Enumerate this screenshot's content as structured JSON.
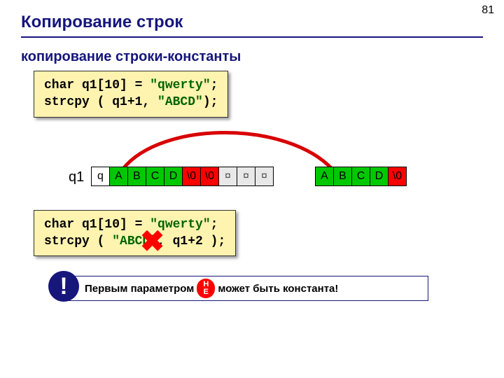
{
  "page_number": "81",
  "title": "Копирование строк",
  "subhead": "копирование строки-константы",
  "code1": {
    "line1_a": "char q1[10] = ",
    "line1_b": "\"qwerty\"",
    "line1_c": ";",
    "line2_a": "strcpy ( q1+1, ",
    "line2_b": "\"ABCD\"",
    "line2_c": ");"
  },
  "array_label": "q1",
  "array1": [
    "q",
    "A",
    "B",
    "C",
    "D",
    "\\0",
    "\\0",
    "¤",
    "¤",
    "¤"
  ],
  "array2": [
    "A",
    "B",
    "C",
    "D",
    "\\0"
  ],
  "code2": {
    "line1_a": "char q1[10] = ",
    "line1_b": "\"qwerty\"",
    "line1_c": ";",
    "line2_a": "strcpy ( ",
    "line2_b": "\"ABCD\"",
    "line2_c": ", q1+2 );"
  },
  "notice": {
    "bang": "!",
    "before": "Первым параметром",
    "ne1": "Н",
    "ne2": "Е",
    "after": "может быть константа!"
  }
}
